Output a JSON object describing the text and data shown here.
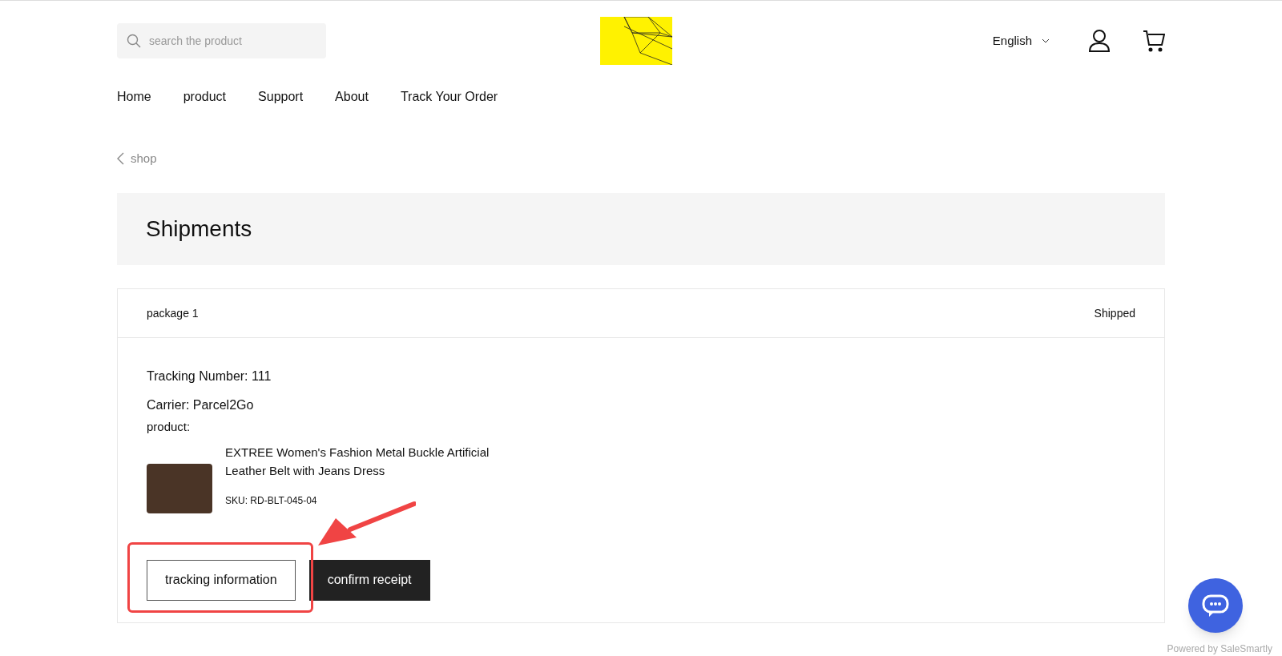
{
  "header": {
    "search": {
      "placeholder": "search the product"
    },
    "language": "English"
  },
  "nav": [
    "Home",
    "product",
    "Support",
    "About",
    "Track Your Order"
  ],
  "breadcrumb": "shop",
  "page_title": "Shipments",
  "package": {
    "name": "package 1",
    "status": "Shipped",
    "tracking_number": "Tracking Number: 111",
    "carrier": "Carrier: Parcel2Go",
    "product_label": "product:",
    "product": {
      "title": "EXTREE Women's Fashion Metal Buckle Artificial Leather Belt with Jeans Dress",
      "sku": "SKU: RD-BLT-045-04"
    },
    "buttons": [
      {
        "label": "tracking information",
        "kind": "outline"
      },
      {
        "label": "confirm receipt",
        "kind": "filled"
      }
    ]
  },
  "chat": {
    "powered_by": "Powered by SaleSmartly"
  }
}
